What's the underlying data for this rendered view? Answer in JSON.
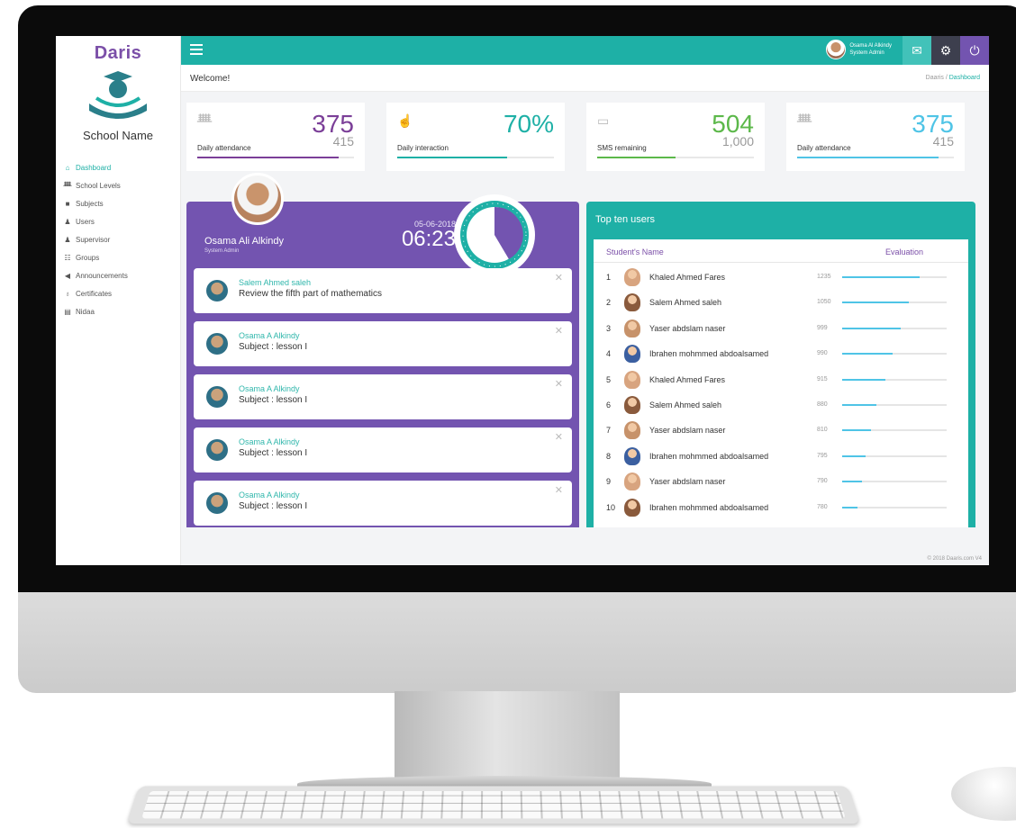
{
  "app": {
    "logo": "Daris",
    "school_name": "School Name",
    "brand_colors": {
      "teal": "#1eb0a6",
      "purple": "#7354b0",
      "dark": "#3d3f4e"
    }
  },
  "sidebar": {
    "items": [
      {
        "label": "Dashboard",
        "icon": "home-icon",
        "active": true
      },
      {
        "label": "School Levels",
        "icon": "people-icon"
      },
      {
        "label": "Subjects",
        "icon": "book-icon"
      },
      {
        "label": "Users",
        "icon": "user-icon"
      },
      {
        "label": "Supervisor",
        "icon": "supervisor-icon"
      },
      {
        "label": "Groups",
        "icon": "groups-icon"
      },
      {
        "label": "Announcements",
        "icon": "megaphone-icon"
      },
      {
        "label": "Certificates",
        "icon": "certificate-icon"
      },
      {
        "label": "Nidaa",
        "icon": "building-icon"
      }
    ]
  },
  "topbar": {
    "user_name": "Osama Al Alkindy",
    "user_role": "System Admin",
    "icons": [
      "menu-icon",
      "mail-icon",
      "gear-icon",
      "power-icon"
    ]
  },
  "header": {
    "welcome": "Welcome!",
    "breadcrumb_root": "Daaris",
    "breadcrumb_current": "Dashboard"
  },
  "stats": [
    {
      "label": "Daily attendance",
      "value": "375",
      "sub": "415",
      "color": "#7b3f98",
      "fill": 0.9
    },
    {
      "label": "Daily interaction",
      "value": "70%",
      "sub": "",
      "color": "#1eb0a6",
      "fill": 0.7
    },
    {
      "label": "SMS remaining",
      "value": "504",
      "sub": "1,000",
      "color": "#5cb84a",
      "fill": 0.5
    },
    {
      "label": "Daily attendance",
      "value": "375",
      "sub": "415",
      "color": "#4fc4e6",
      "fill": 0.9
    }
  ],
  "activity": {
    "name": "Osama Ali Alkindy",
    "role": "System Admin",
    "date": "05-06-2018",
    "time": "06:23",
    "messages": [
      {
        "sender": "Salem Ahmed saleh",
        "text": "Review the fifth part of mathematics"
      },
      {
        "sender": "Osama A Alkindy",
        "text": "Subject : lesson I"
      },
      {
        "sender": "Osama A Alkindy",
        "text": "Subject : lesson I"
      },
      {
        "sender": "Osama A Alkindy",
        "text": "Subject : lesson I"
      },
      {
        "sender": "Osama A Alkindy",
        "text": "Subject : lesson I"
      }
    ]
  },
  "topten": {
    "title": "Top ten users",
    "col_name": "Student's Name",
    "col_eval": "Evaluation",
    "rows": [
      {
        "rank": "1",
        "name": "Khaled Ahmed Fares",
        "score": "1235",
        "fill": 0.74
      },
      {
        "rank": "2",
        "name": "Salem Ahmed saleh",
        "score": "1050",
        "fill": 0.64
      },
      {
        "rank": "3",
        "name": "Yaser abdslam naser",
        "score": "999",
        "fill": 0.56
      },
      {
        "rank": "4",
        "name": "Ibrahen mohmmed abdoalsamed",
        "score": "990",
        "fill": 0.48
      },
      {
        "rank": "5",
        "name": "Khaled Ahmed Fares",
        "score": "915",
        "fill": 0.41
      },
      {
        "rank": "6",
        "name": "Salem Ahmed saleh",
        "score": "880",
        "fill": 0.33
      },
      {
        "rank": "7",
        "name": "Yaser abdslam naser",
        "score": "810",
        "fill": 0.28
      },
      {
        "rank": "8",
        "name": "Ibrahen mohmmed abdoalsamed",
        "score": "795",
        "fill": 0.22
      },
      {
        "rank": "9",
        "name": "Yaser abdslam naser",
        "score": "790",
        "fill": 0.19
      },
      {
        "rank": "10",
        "name": "Ibrahen mohmmed abdoalsamed",
        "score": "780",
        "fill": 0.15
      }
    ]
  },
  "footer": "© 2018 Daaris.com V4"
}
